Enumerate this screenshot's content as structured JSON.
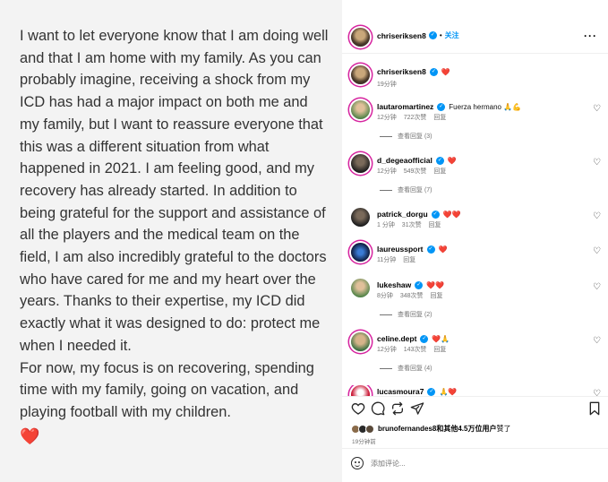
{
  "post_text": {
    "paragraph_1": "I want to let everyone know that I am doing well and that I am home with my family. As you can probably imagine, receiving a shock from my ICD has had a major impact on both me and my family, but I want to reassure everyone that this was a different situation from what happened in 2021. I am feeling good, and my recovery has already started. In addition to being grateful for the support and assistance of all the players and the medical team on the field, I am also incredibly grateful to the doctors who have cared for me and my heart over the years. Thanks to their expertise, my ICD did exactly what it was designed to do: protect me when I needed it.",
    "paragraph_2": "For now, my focus is on recovering, spending time with my family, going on vacation, and playing football with my children.",
    "emoji": "❤️"
  },
  "header": {
    "username": "chriseriksen8",
    "separator": "•",
    "follow_label": "关注",
    "more_label": "···"
  },
  "caption": {
    "username": "chriseriksen8",
    "emoji": "❤️",
    "time": "19分钟"
  },
  "comments": [
    {
      "username": "lautaromartinez",
      "text": "Fuerza hermano 🙏💪",
      "time": "12分钟",
      "likes": "722次赞",
      "reply": "回复",
      "view_replies": "查看回复 (3)"
    },
    {
      "username": "d_degeaofficial",
      "text": "❤️",
      "time": "12分钟",
      "likes": "549次赞",
      "reply": "回复",
      "view_replies": "查看回复 (7)"
    },
    {
      "username": "patrick_dorgu",
      "text": "❤️❤️",
      "time": "1 分钟",
      "likes": "31次赞",
      "reply": "回复",
      "view_replies": ""
    },
    {
      "username": "laureussport",
      "text": "❤️",
      "time": "11分钟",
      "likes": "",
      "reply": "回复",
      "view_replies": ""
    },
    {
      "username": "lukeshaw",
      "text": "❤️❤️",
      "time": "8分钟",
      "likes": "348次赞",
      "reply": "回复",
      "view_replies": "查看回复 (2)"
    },
    {
      "username": "celine.dept",
      "text": "❤️🙏",
      "time": "12分钟",
      "likes": "143次赞",
      "reply": "回复",
      "view_replies": "查看回复 (4)"
    },
    {
      "username": "lucasmoura7",
      "text": "🙏❤️",
      "time": "",
      "likes": "",
      "reply": "",
      "view_replies": ""
    }
  ],
  "actions": {
    "like_icon": "heart-outline-icon",
    "comment_icon": "comment-bubble-icon",
    "repost_icon": "repost-icon",
    "share_icon": "paper-plane-icon",
    "save_icon": "bookmark-icon"
  },
  "likes": {
    "user": "brunofernandes8",
    "rest": "和其他4.5万位用户",
    "suffix": "赞了"
  },
  "post_time": "19分钟前",
  "add_comment": {
    "placeholder": "添加评论..."
  },
  "colors": {
    "accent": "#0095f6",
    "heart": "#ed4956",
    "story_ring": "#d6249f"
  }
}
